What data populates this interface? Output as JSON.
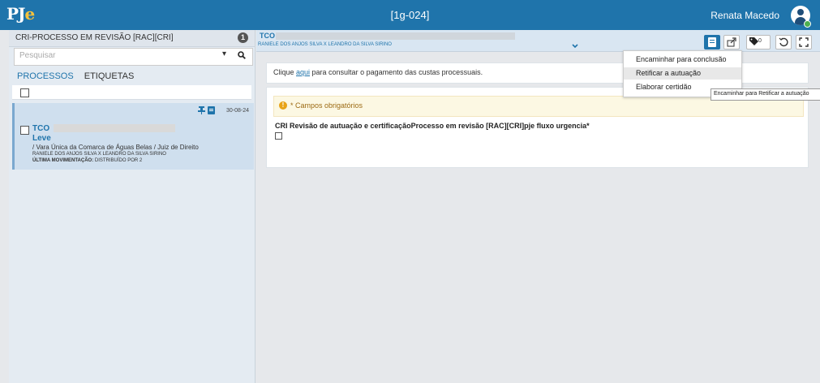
{
  "header": {
    "logo_text": "PJe",
    "title": "[1g-024]",
    "user_name": "Renata Macedo"
  },
  "sidebar": {
    "queue_title": "CRI-PROCESSO EM REVISÃO [RAC][CRI]",
    "queue_count": "1",
    "search_placeholder": "Pesquisar",
    "tabs": [
      "PROCESSOS",
      "ETIQUETAS"
    ],
    "process_card": {
      "date": "30-08-24",
      "type": "TCO",
      "class_label": "Leve",
      "court": "/ Vara Única da Comarca de Águas Belas / Juiz de Direito",
      "parties": "RANIELE DOS ANJOS SILVA X LEANDRO DA SILVA SIRINO",
      "last_movement_label": "ÚLTIMA MOVIMENTAÇÃO:",
      "last_movement_value": "DISTRIBUÍDO POR 2"
    }
  },
  "main": {
    "process_type": "TCO",
    "parties": "RANIELE DOS ANJOS SILVA X LEANDRO DA SILVA SIRINO",
    "toolbar": {
      "tag_count": "0"
    },
    "notice_before": "Clique ",
    "notice_link": "aqui",
    "notice_after": " para consultar o pagamento das custas processuais.",
    "required_notice": "* Campos obrigatórios",
    "field_label": "CRI Revisão de autuação e certificaçãoProcesso em revisão [RAC][CRI]pje fluxo urgencia*"
  },
  "dropdown": {
    "items": [
      "Encaminhar para conclusão",
      "Retificar a autuação",
      "Elaborar certidão"
    ],
    "highlighted_index": 1
  },
  "tooltip": "Encaminhar para Retificar a autuação",
  "colors": {
    "brand": "#1f74ab",
    "logo_accent": "#f5c23c",
    "card_bg": "#cfdfee",
    "warning_bg": "#fcf8e3"
  }
}
